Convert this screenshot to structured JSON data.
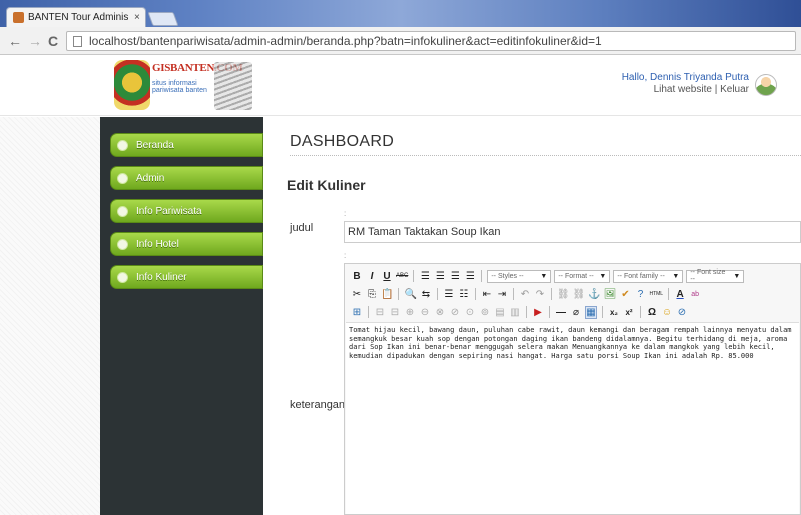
{
  "browser": {
    "tab_title": "BANTEN Tour Administra",
    "tab_close": "×",
    "url": "localhost/bantenpariwisata/admin-admin/beranda.php?batn=infokuliner&act=editinfokuliner&id=1",
    "back_icon": "←",
    "forward_icon": "→",
    "reload_icon": "C"
  },
  "header": {
    "brand": "GISBANTEN.COM",
    "tagline": "situs informasi pariwisata banten",
    "greeting": "Hallo, Dennis Triyanda Putra",
    "links": "Lihat website | Keluar"
  },
  "sidebar": {
    "items": [
      {
        "label": "Beranda"
      },
      {
        "label": "Admin"
      },
      {
        "label": "Info Pariwisata"
      },
      {
        "label": "Info Hotel"
      },
      {
        "label": "Info Kuliner"
      }
    ]
  },
  "main": {
    "page_title": "DASHBOARD",
    "section_title": "Edit Kuliner",
    "judul_label": "judul",
    "judul_value": "RM Taman Taktakan Soup Ikan",
    "keterangan_label": "keterangan",
    "keterangan_value": "Tomat hijau kecil, bawang daun, puluhan cabe rawit, daun kemangi dan beragam rempah lainnya menyatu dalam semangkuk besar kuah sop dengan potongan daging ikan bandeng didalamnya. Begitu terhidang di meja, aroma dari Sop Ikan ini benar-benar menggugah selera makan Menuangkannya ke dalam mangkok yang lebih kecil, kemudian dipadukan dengan sepiring nasi hangat. Harga satu porsi Soup Ikan ini adalah Rp. 85.000"
  },
  "editor": {
    "row1": [
      "B",
      "I",
      "U",
      "ABC"
    ],
    "styles": "-- Styles --",
    "format": "-- Format --",
    "font_family": "-- Font family --",
    "font_size": "-- Font size --",
    "row2": [
      "✂",
      "⎘",
      "📋",
      "🔍",
      "⇆",
      "☰",
      "☷",
      "⇤",
      "⇥",
      "↶",
      "↷",
      "⛓",
      "⛓",
      "⚓",
      "🖼",
      "✔",
      "?",
      "HTML",
      "A",
      "ab"
    ],
    "row3": [
      "⊞",
      "⊟",
      "⊟",
      "⊕",
      "⊖",
      "⊗",
      "⊘",
      "⊙",
      "⊚",
      "▤",
      "▥",
      "▶",
      "—",
      "⌀",
      "▦",
      "x₂",
      "x²",
      "Ω",
      "☺",
      "⊘"
    ]
  }
}
